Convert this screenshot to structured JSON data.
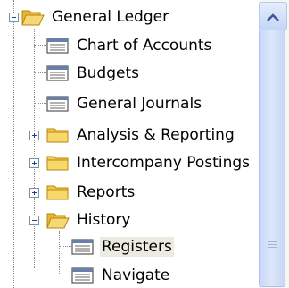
{
  "tree": {
    "root": {
      "label": "General Ledger",
      "expanded": true,
      "icon": "open-folder-icon"
    },
    "items": [
      {
        "label": "Chart of Accounts",
        "icon": "form-icon"
      },
      {
        "label": "Budgets",
        "icon": "form-icon"
      },
      {
        "label": "General Journals",
        "icon": "form-icon"
      },
      {
        "label": "Analysis & Reporting",
        "icon": "folder-icon",
        "expanded": false
      },
      {
        "label": "Intercompany Postings",
        "icon": "folder-icon",
        "expanded": false
      },
      {
        "label": "Reports",
        "icon": "folder-icon",
        "expanded": false
      },
      {
        "label": "History",
        "icon": "open-folder-icon",
        "expanded": true
      }
    ],
    "history_items": [
      {
        "label": "Registers",
        "icon": "form-icon",
        "selected": true
      },
      {
        "label": "Navigate",
        "icon": "form-icon"
      }
    ]
  },
  "colors": {
    "folder": "#f2c94c",
    "selection": "#ecebe2",
    "scrollbar": "#c8d8f8"
  }
}
